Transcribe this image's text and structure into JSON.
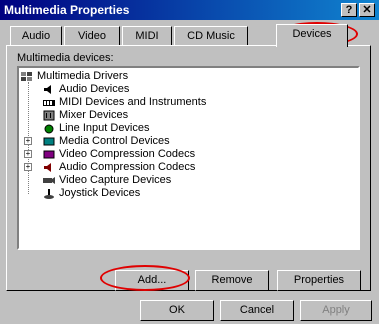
{
  "window": {
    "title": "Multimedia Properties",
    "help_label": "?",
    "close_label": "✕"
  },
  "tabs": [
    {
      "label": "Audio"
    },
    {
      "label": "Video"
    },
    {
      "label": "MIDI"
    },
    {
      "label": "CD Music"
    },
    {
      "label": "Devices"
    }
  ],
  "devices": {
    "list_label": "Multimedia devices:",
    "tree": [
      {
        "label": "Multimedia Drivers",
        "icon": "multimedia-drivers-icon",
        "expander": ""
      },
      {
        "label": "Audio Devices",
        "icon": "speaker-icon",
        "expander": ""
      },
      {
        "label": "MIDI Devices and Instruments",
        "icon": "midi-icon",
        "expander": ""
      },
      {
        "label": "Mixer Devices",
        "icon": "mixer-icon",
        "expander": ""
      },
      {
        "label": "Line Input Devices",
        "icon": "line-input-icon",
        "expander": ""
      },
      {
        "label": "Media Control Devices",
        "icon": "media-control-icon",
        "expander": "+"
      },
      {
        "label": "Video Compression Codecs",
        "icon": "video-codec-icon",
        "expander": "+"
      },
      {
        "label": "Audio Compression Codecs",
        "icon": "audio-codec-icon",
        "expander": "+"
      },
      {
        "label": "Video Capture Devices",
        "icon": "video-capture-icon",
        "expander": ""
      },
      {
        "label": "Joystick Devices",
        "icon": "joystick-icon",
        "expander": ""
      }
    ],
    "buttons": {
      "add": "Add...",
      "remove": "Remove",
      "properties": "Properties"
    }
  },
  "footer": {
    "ok": "OK",
    "cancel": "Cancel",
    "apply": "Apply"
  },
  "colors": {
    "titlebar": "#000080",
    "face": "#c0c0c0",
    "highlight_ring": "#e00000"
  }
}
